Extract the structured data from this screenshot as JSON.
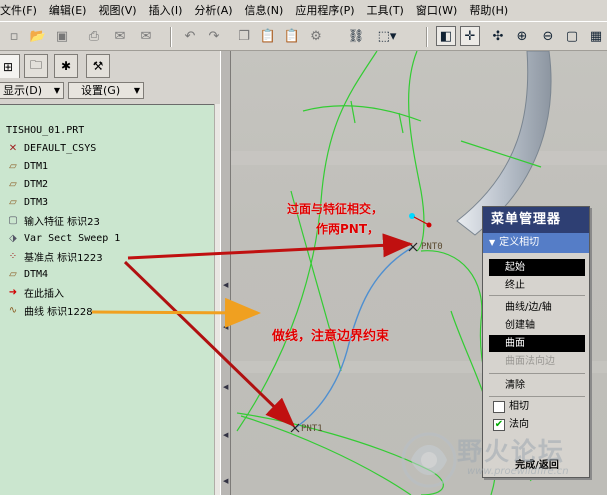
{
  "menubar": {
    "items": [
      "文件(F)",
      "编辑(E)",
      "视图(V)",
      "插入(I)",
      "分析(A)",
      "信息(N)",
      "应用程序(P)",
      "工具(T)",
      "窗口(W)",
      "帮助(H)"
    ]
  },
  "left_panel": {
    "show_menu": "显示(D)",
    "settings_menu": "设置(G)",
    "tree": [
      {
        "icon": "part-icon",
        "label": "TISHOU_01.PRT"
      },
      {
        "icon": "csys-icon",
        "label": "DEFAULT_CSYS"
      },
      {
        "icon": "datum-plane-icon",
        "label": "DTM1"
      },
      {
        "icon": "datum-plane-icon",
        "label": "DTM2"
      },
      {
        "icon": "datum-plane-icon",
        "label": "DTM3"
      },
      {
        "icon": "import-icon",
        "label": "输入特征 标识23"
      },
      {
        "icon": "sweep-icon",
        "label": "Var Sect Sweep 1"
      },
      {
        "icon": "datum-point-icon",
        "label": "基准点 标识1223"
      },
      {
        "icon": "datum-plane-icon",
        "label": "DTM4"
      },
      {
        "icon": "insert-here-icon",
        "label": "在此插入"
      },
      {
        "icon": "datum-curve-icon",
        "label": "曲线 标识1228"
      }
    ]
  },
  "graphics": {
    "point_labels": [
      "PNT0",
      "PNT1"
    ],
    "annotation_1_line1": "过面与特征相交，",
    "annotation_1_line2": "作两PNT，",
    "annotation_2": "做线，注意边界约束"
  },
  "menu_manager": {
    "title": "菜单管理器",
    "section": "定义相切",
    "items": [
      {
        "label": "起始",
        "state": "selected"
      },
      {
        "label": "终止",
        "state": "normal"
      },
      {
        "label": "曲线/边/轴",
        "state": "normal"
      },
      {
        "label": "创建轴",
        "state": "normal"
      },
      {
        "label": "曲面",
        "state": "selected"
      },
      {
        "label": "曲面法向边",
        "state": "disabled"
      },
      {
        "label": "清除",
        "state": "normal"
      }
    ],
    "checkboxes": [
      {
        "label": "相切",
        "checked": false
      },
      {
        "label": "法向",
        "checked": true
      }
    ],
    "done": "完成/返回"
  },
  "watermark": {
    "text": "野火论坛",
    "url": "www.proewildfire.cn"
  },
  "colors": {
    "annotation_red": "#e00000",
    "arrow_orange": "#f0a020",
    "curve_green": "#33cc33",
    "curve_blue": "#4f8fd0",
    "menu_title_bg": "#2e3f73",
    "menu_section_bg": "#557dc7",
    "tree_bg": "#cbe6cf"
  }
}
